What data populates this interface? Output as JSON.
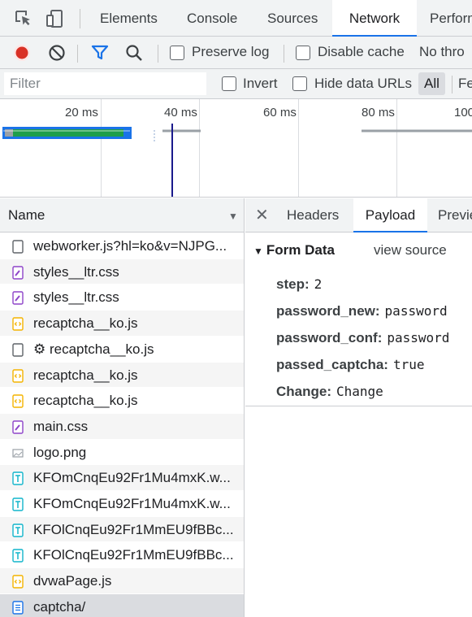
{
  "tabs": [
    "Elements",
    "Console",
    "Sources",
    "Network",
    "Perform"
  ],
  "active_tab": "Network",
  "toolbar": {
    "preserve_log": "Preserve log",
    "disable_cache": "Disable cache",
    "throttle": "No thro"
  },
  "filter": {
    "placeholder": "Filter",
    "invert": "Invert",
    "hide_data_urls": "Hide data URLs",
    "all": "All",
    "fe": "Fe"
  },
  "overview": {
    "ticks": [
      "20 ms",
      "40 ms",
      "60 ms",
      "80 ms",
      "100"
    ]
  },
  "list": {
    "header": "Name",
    "rows": [
      {
        "name": "webworker.js?hl=ko&v=NJPG...",
        "type": "doc"
      },
      {
        "name": "styles__ltr.css",
        "type": "css"
      },
      {
        "name": "styles__ltr.css",
        "type": "css"
      },
      {
        "name": "recaptcha__ko.js",
        "type": "js"
      },
      {
        "name": "⚙ recaptcha__ko.js",
        "type": "doc"
      },
      {
        "name": "recaptcha__ko.js",
        "type": "js"
      },
      {
        "name": "recaptcha__ko.js",
        "type": "js"
      },
      {
        "name": "main.css",
        "type": "css"
      },
      {
        "name": "logo.png",
        "type": "img"
      },
      {
        "name": "KFOmCnqEu92Fr1Mu4mxK.w...",
        "type": "font"
      },
      {
        "name": "KFOmCnqEu92Fr1Mu4mxK.w...",
        "type": "font"
      },
      {
        "name": "KFOlCnqEu92Fr1MmEU9fBBc...",
        "type": "font"
      },
      {
        "name": "KFOlCnqEu92Fr1MmEU9fBBc...",
        "type": "font"
      },
      {
        "name": "dvwaPage.js",
        "type": "js"
      },
      {
        "name": "captcha/",
        "type": "page"
      }
    ]
  },
  "details": {
    "tabs": [
      "Headers",
      "Payload",
      "Previe"
    ],
    "active": "Payload",
    "section_title": "Form Data",
    "view_source": "view source",
    "fields": [
      {
        "key": "step:",
        "value": "2"
      },
      {
        "key": "password_new:",
        "value": "password"
      },
      {
        "key": "password_conf:",
        "value": "password"
      },
      {
        "key": "passed_captcha:",
        "value": "true"
      },
      {
        "key": "Change:",
        "value": "Change"
      }
    ]
  },
  "colors": {
    "accent": "#1a73e8",
    "record": "#d93025",
    "css_icon": "#8e44c9",
    "js_icon": "#f4b400",
    "font_icon": "#12b5cb",
    "bar_green": "#1e9e4a"
  }
}
